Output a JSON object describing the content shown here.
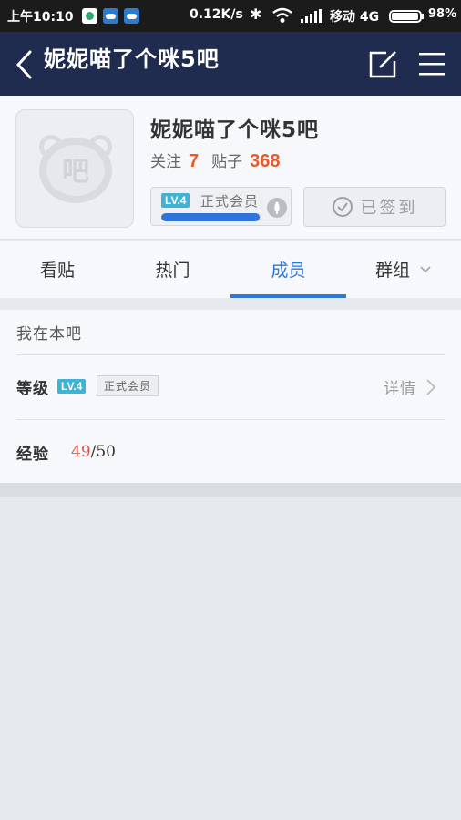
{
  "status_bar": {
    "time": "上午10:10",
    "speed": "0.12K/s",
    "carrier": "移动 4G",
    "battery": "98%"
  },
  "nav": {
    "title": "妮妮喵了个咪5吧"
  },
  "forum": {
    "name": "妮妮喵了个咪5吧",
    "avatar_text": "吧",
    "follow_label": "关注",
    "follow_count": "7",
    "posts_label": "贴子",
    "posts_count": "368",
    "level_badge": "LV.4",
    "member_title": "正式会员",
    "level_progress": 0.98,
    "signed_label": "已签到"
  },
  "tabs": [
    {
      "label": "看贴"
    },
    {
      "label": "热门"
    },
    {
      "label": "成员"
    },
    {
      "label": "群组"
    }
  ],
  "my_section": {
    "title": "我在本吧",
    "level_label": "等级",
    "level_badge": "LV.4",
    "member_title": "正式会员",
    "detail_label": "详情",
    "exp_label": "经验",
    "exp_current": "49",
    "exp_total": "/50"
  },
  "colors": {
    "nav_bg": "#202c4f",
    "accent": "#2d77d9",
    "count_orange": "#e85a2a",
    "level_badge": "#3fb3d6",
    "exp_red": "#e0524a"
  }
}
